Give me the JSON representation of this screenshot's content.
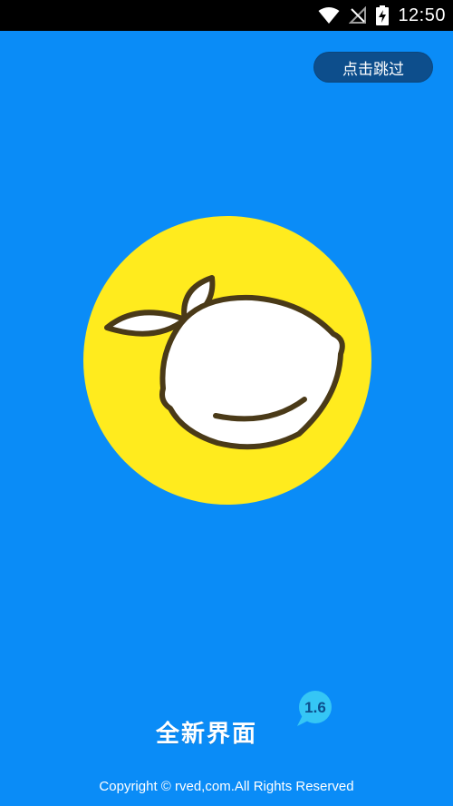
{
  "status_bar": {
    "time": "12:50",
    "icons": [
      "wifi-icon",
      "no-signal-icon",
      "battery-charging-icon"
    ]
  },
  "skip_label": "点击跳过",
  "logo": {
    "icon": "lemon-icon",
    "circle_color": "#FFEB1E",
    "outline_color": "#4A3A18"
  },
  "brand": {
    "title": "全新界面",
    "version": "1.6"
  },
  "footer": {
    "copyright": "Copyright © rved,com.All Rights Reserved"
  },
  "colors": {
    "background": "#0A8CF7",
    "skip_button": "#0D4E8C",
    "badge": "#35C6F5"
  }
}
